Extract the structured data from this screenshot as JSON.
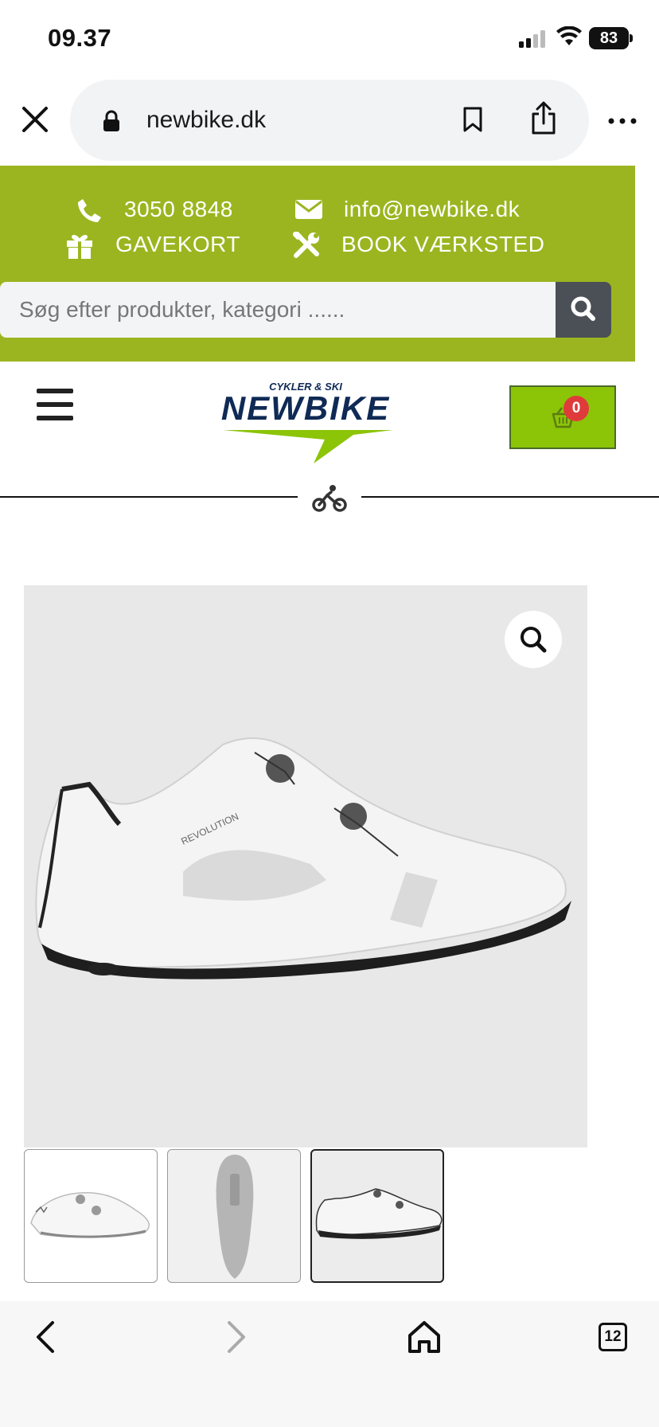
{
  "status_bar": {
    "time": "09.37",
    "battery": "83"
  },
  "browser": {
    "url": "newbike.dk"
  },
  "header": {
    "phone": "3050 8848",
    "email": "info@newbike.dk",
    "giftcard": "GAVEKORT",
    "workshop": "BOOK VÆRKSTED",
    "search_placeholder": "Søg efter produkter, kategori ......"
  },
  "logo": {
    "tagline": "CYKLER & SKI",
    "name": "NEWBIKE"
  },
  "cart": {
    "count": "0"
  },
  "product": {
    "shoe_label": "REVOLUTION",
    "thumbnails": [
      "front-white",
      "sole",
      "side-white"
    ]
  },
  "tabs": {
    "count": "12"
  },
  "colors": {
    "brand_green": "#9bb520",
    "cart_green": "#8cc408",
    "badge_red": "#e03b3b"
  }
}
